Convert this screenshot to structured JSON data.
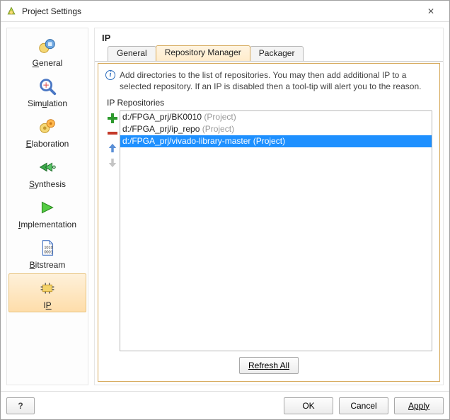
{
  "window": {
    "title": "Project Settings",
    "close_glyph": "✕"
  },
  "sidebar": {
    "items": [
      {
        "label_pre": "",
        "label_u": "G",
        "label_post": "eneral",
        "icon": "settings-icon",
        "selected": false
      },
      {
        "label_pre": "Sim",
        "label_u": "u",
        "label_post": "lation",
        "icon": "search-icon",
        "selected": false
      },
      {
        "label_pre": "",
        "label_u": "E",
        "label_post": "laboration",
        "icon": "gears-icon",
        "selected": false
      },
      {
        "label_pre": "",
        "label_u": "S",
        "label_post": "ynthesis",
        "icon": "arrows-icon",
        "selected": false
      },
      {
        "label_pre": "",
        "label_u": "I",
        "label_post": "mplementation",
        "icon": "play-icon",
        "selected": false
      },
      {
        "label_pre": "",
        "label_u": "B",
        "label_post": "itstream",
        "icon": "file-icon",
        "selected": false
      },
      {
        "label_pre": "I",
        "label_u": "P",
        "label_post": "",
        "icon": "ip-icon",
        "selected": true
      }
    ]
  },
  "main": {
    "title": "IP",
    "tabs": [
      {
        "label": "General",
        "active": false
      },
      {
        "label": "Repository Manager",
        "active": true
      },
      {
        "label": "Packager",
        "active": false
      }
    ],
    "info_text": "Add directories to the list of repositories. You may then add additional IP to a selected repository. If an IP is disabled then a tool-tip will alert you to the reason.",
    "repo": {
      "label": "IP Repositories",
      "items": [
        {
          "path": "d:/FPGA_prj/BK0010",
          "suffix": " (Project)",
          "selected": false
        },
        {
          "path": "d:/FPGA_prj/ip_repo",
          "suffix": " (Project)",
          "selected": false
        },
        {
          "path": "d:/FPGA_prj/vivado-library-master",
          "suffix": " (Project)",
          "selected": true
        }
      ],
      "refresh_label": "Refresh All"
    }
  },
  "footer": {
    "help": "?",
    "ok": "OK",
    "cancel": "Cancel",
    "apply": "Apply"
  }
}
